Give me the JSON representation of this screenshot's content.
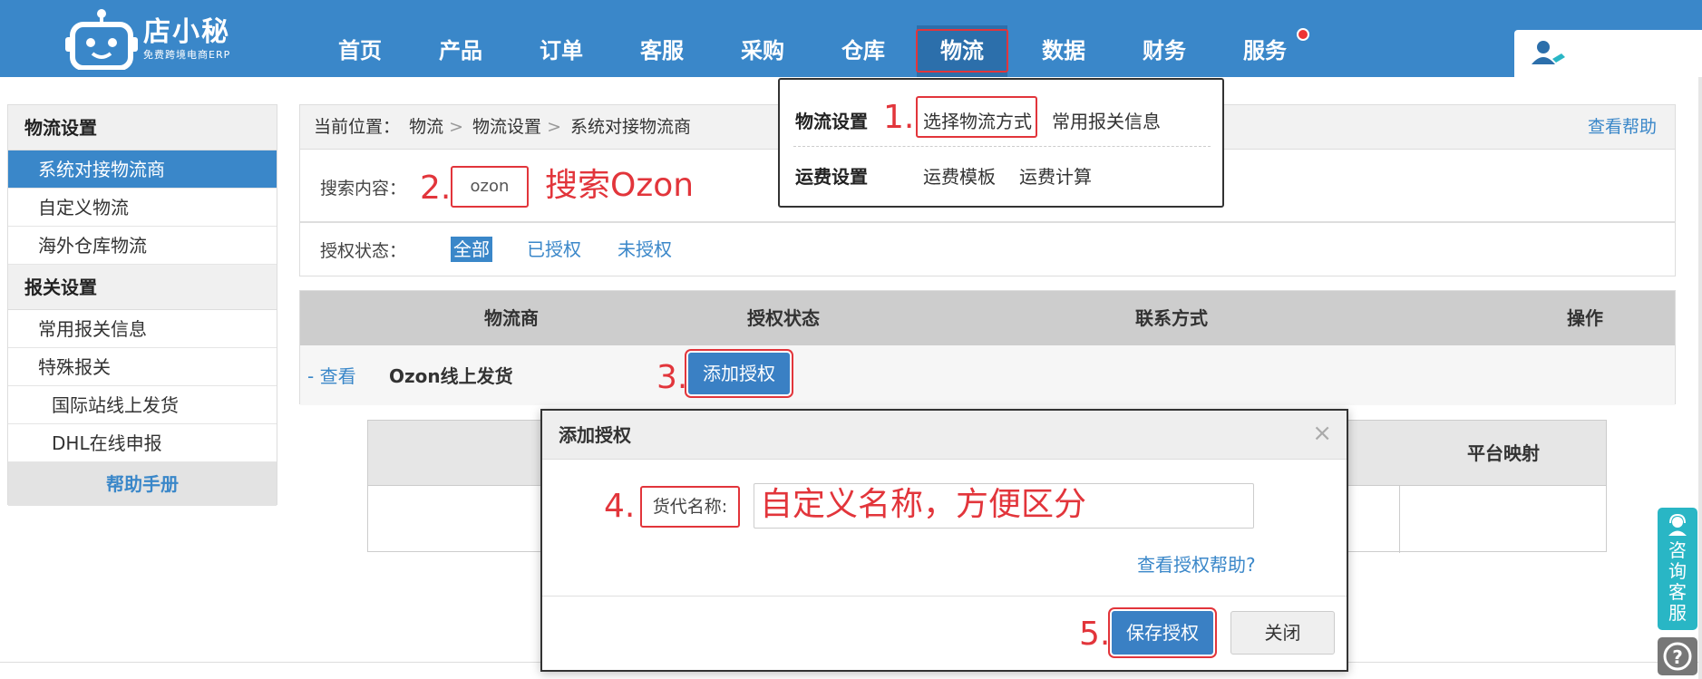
{
  "app": {
    "logo_name": "店小秘",
    "logo_sub": "免费跨境电商ERP",
    "nav": [
      "首页",
      "产品",
      "订单",
      "客服",
      "采购",
      "仓库",
      "物流",
      "数据",
      "财务",
      "服务"
    ],
    "active_nav": "物流"
  },
  "sidebar": {
    "group1": "物流设置",
    "group1_items": [
      "系统对接物流商",
      "自定义物流",
      "海外仓库物流"
    ],
    "group2": "报关设置",
    "group2_items": [
      "常用报关信息",
      "特殊报关"
    ],
    "group2_sub_items": [
      "国际站线上发货",
      "DHL在线申报"
    ],
    "help": "帮助手册"
  },
  "breadcrumb": {
    "prefix": "当前位置：",
    "items": [
      "物流",
      "物流设置",
      "系统对接物流商"
    ],
    "sep": ">",
    "help": "查看帮助"
  },
  "search": {
    "label": "搜索内容：",
    "value": "ozon"
  },
  "filter": {
    "label": "授权状态：",
    "options": [
      "全部",
      "已授权",
      "未授权"
    ]
  },
  "table": {
    "headers": [
      "物流商",
      "授权状态",
      "联系方式",
      "操作"
    ],
    "row": {
      "view": "- 查看",
      "carrier": "Ozon线上发货",
      "action": "添加授权"
    }
  },
  "bg_table": {
    "col_title": "平台映射"
  },
  "dropdown": {
    "section1": "物流设置",
    "section1_links": [
      "选择物流方式",
      "常用报关信息"
    ],
    "section2": "运费设置",
    "section2_links": [
      "运费模板",
      "运费计算"
    ]
  },
  "modal": {
    "title": "添加授权",
    "close": "×",
    "field_label": "货代名称:",
    "help": "查看授权帮助?",
    "save": "保存授权",
    "cancel": "关闭"
  },
  "annotations": {
    "s1": "1.",
    "s2": "2.",
    "s2_text": "搜索Ozon",
    "s3": "3.",
    "s4": "4.",
    "s4_text": "自定义名称，方便区分",
    "s5": "5."
  },
  "float": {
    "consult": "咨询客服",
    "help_icon": "?"
  },
  "colors": {
    "primary": "#3a87c9",
    "annotation": "#e2353b",
    "consult": "#29b6c5"
  },
  "icons": [
    "robot-logo-icon",
    "user-add-icon",
    "headset-icon",
    "question-icon",
    "close-icon"
  ]
}
